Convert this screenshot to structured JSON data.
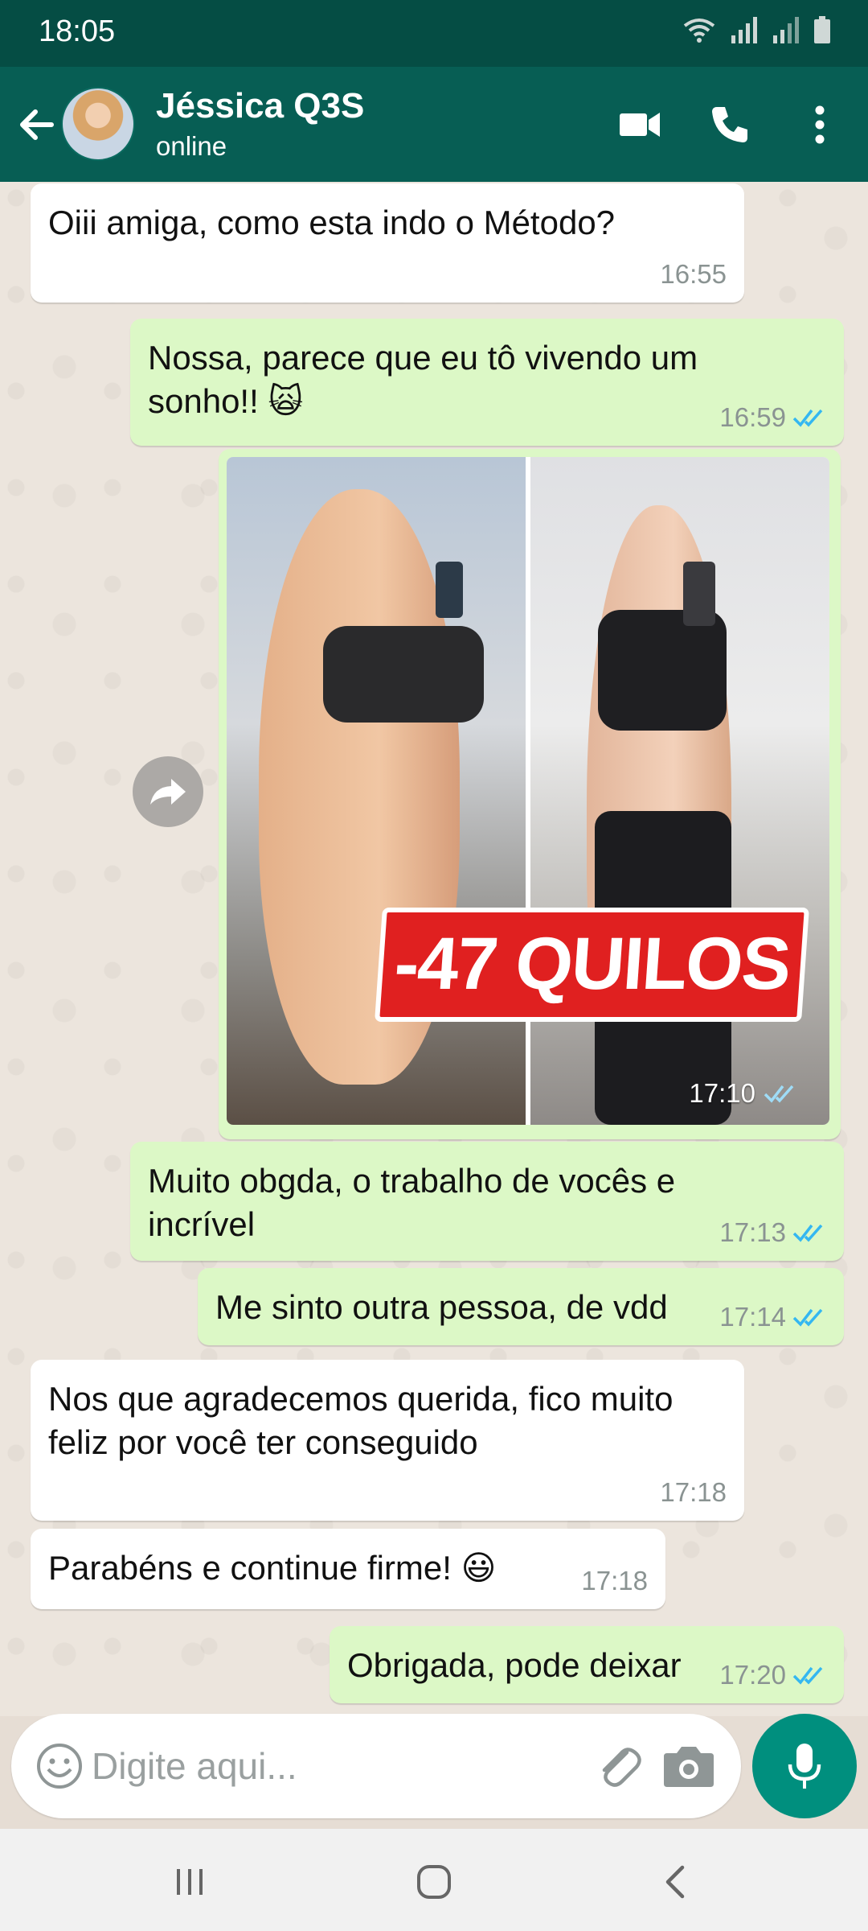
{
  "status_bar": {
    "time": "18:05",
    "icons": [
      "wifi-icon",
      "signal-icon",
      "signal-icon",
      "battery-icon"
    ]
  },
  "header": {
    "contact_name": "Jéssica Q3S",
    "contact_status": "online",
    "actions": [
      "video-call-icon",
      "voice-call-icon",
      "more-options-icon"
    ]
  },
  "messages": [
    {
      "direction": "in",
      "text": "Oiii amiga, como esta indo o Método?",
      "time": "16:55"
    },
    {
      "direction": "out",
      "text": "Nossa, parece que eu tô vivendo um sonho!! 🙀",
      "time": "16:59",
      "status": "read"
    },
    {
      "direction": "out",
      "type": "image",
      "caption_on_image": "-47 QUILOS",
      "time": "17:10",
      "status": "read"
    },
    {
      "direction": "out",
      "text": "Muito obgda, o trabalho de vocês e incrível",
      "time": "17:13",
      "status": "read"
    },
    {
      "direction": "out",
      "text": "Me sinto outra pessoa, de vdd",
      "time": "17:14",
      "status": "read"
    },
    {
      "direction": "in",
      "text": "Nos que agradecemos querida, fico muito feliz por você ter conseguido",
      "time": "17:18"
    },
    {
      "direction": "in",
      "text": "Parabéns e continue firme! 😃",
      "time": "17:18"
    },
    {
      "direction": "out",
      "text": "Obrigada, pode deixar",
      "time": "17:20",
      "status": "read"
    }
  ],
  "composer": {
    "placeholder": "Digite aqui...",
    "value": ""
  },
  "colors": {
    "header": "#075e54",
    "status_bar": "#054d44",
    "outgoing_bubble": "#dcf8c6",
    "incoming_bubble": "#ffffff",
    "read_tick": "#34b7f1",
    "accent": "#008f7e"
  },
  "nav": [
    "recent-apps-icon",
    "home-icon",
    "back-nav-icon"
  ]
}
